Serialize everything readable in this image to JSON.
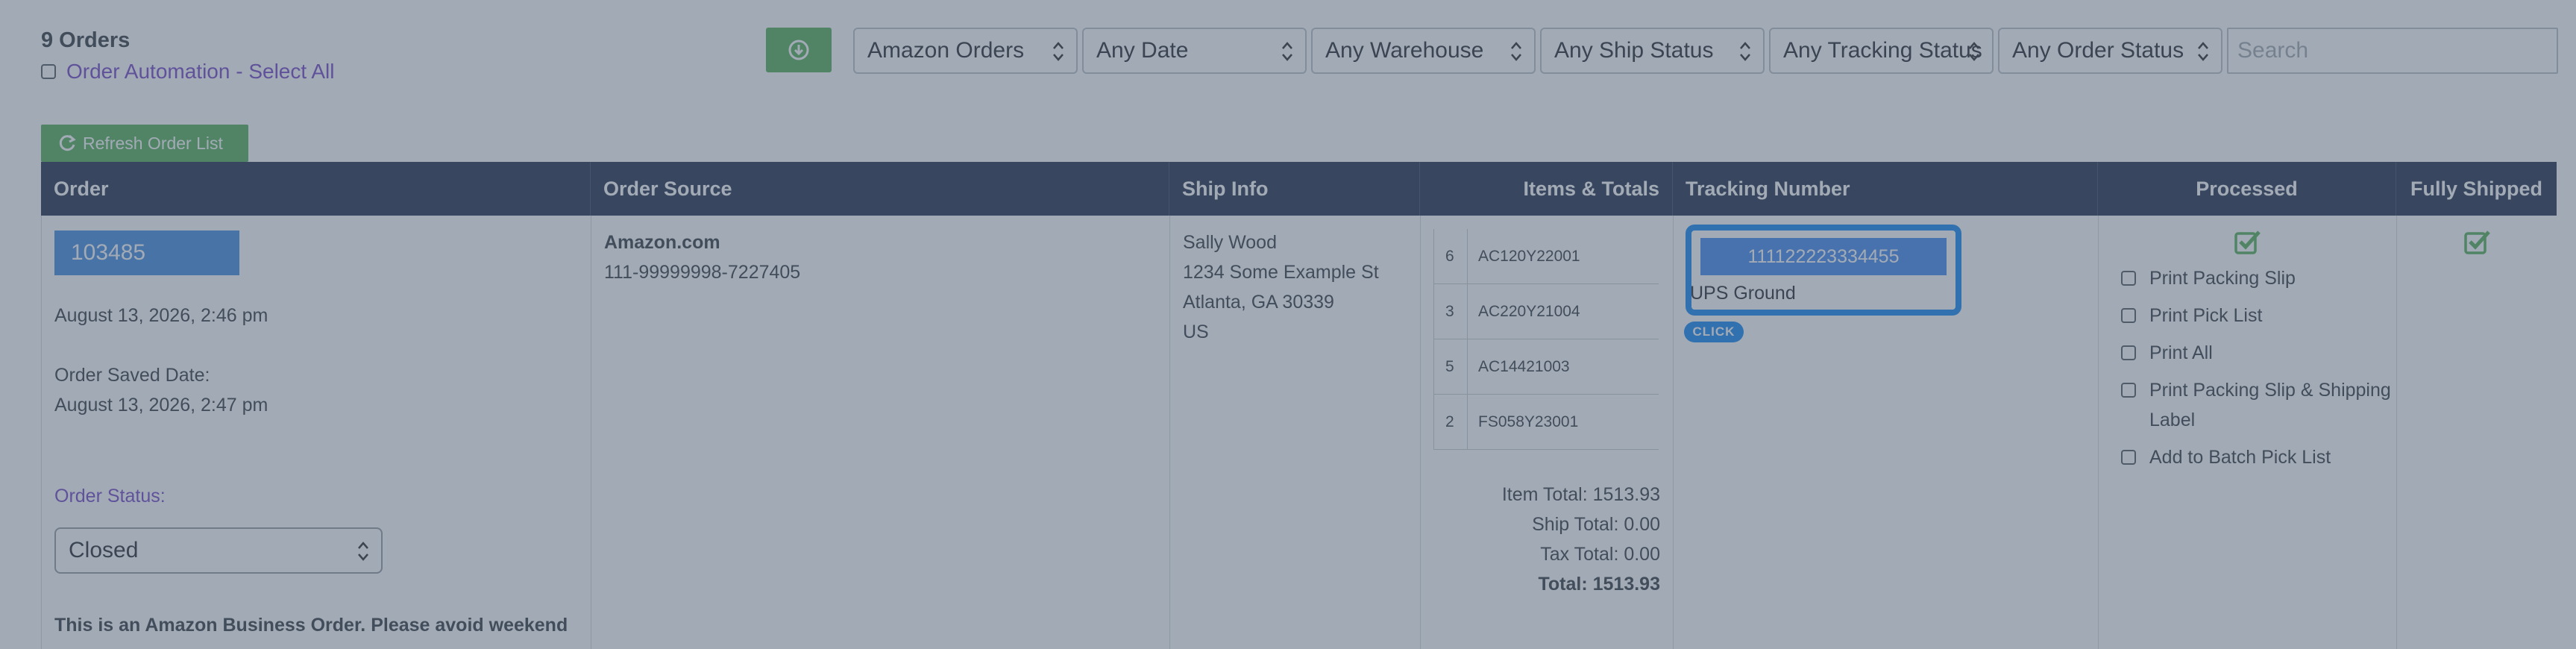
{
  "header": {
    "orders_count": "9 Orders",
    "automation_label": "Order Automation - Select All",
    "download_icon": "download-circle-icon"
  },
  "filters": [
    {
      "value": "Amazon Orders"
    },
    {
      "value": "Any Date"
    },
    {
      "value": "Any Warehouse"
    },
    {
      "value": "Any Ship Status"
    },
    {
      "value": "Any Tracking Status"
    },
    {
      "value": "Any Order Status"
    }
  ],
  "search": {
    "placeholder": "Search"
  },
  "refresh_label": "Refresh Order List",
  "columns": [
    "Order",
    "Order Source",
    "Ship Info",
    "Items & Totals",
    "Tracking Number",
    "Processed",
    "Fully Shipped"
  ],
  "order": {
    "id": "103485",
    "date": "August 13, 2026, 2:46 pm",
    "saved_label": "Order Saved Date:",
    "saved_date": "August 13, 2026, 2:47 pm",
    "status_label": "Order Status:",
    "status_value": "Closed",
    "note": "This is an Amazon Business Order. Please avoid weekend"
  },
  "source": {
    "name": "Amazon.com",
    "number": "111-99999998-7227405"
  },
  "ship": {
    "name": "Sally Wood",
    "street": "1234 Some Example St",
    "city": "Atlanta, GA 30339",
    "country": "US"
  },
  "items": [
    {
      "qty": "6",
      "sku": "AC120Y22001"
    },
    {
      "qty": "3",
      "sku": "AC220Y21004"
    },
    {
      "qty": "5",
      "sku": "AC14421003"
    },
    {
      "qty": "2",
      "sku": "FS058Y23001"
    }
  ],
  "totals": {
    "item": "Item Total: 1513.93",
    "ship": "Ship Total: 0.00",
    "tax": "Tax Total: 0.00",
    "total": "Total: 1513.93"
  },
  "tracking": {
    "number": "111122223334455",
    "carrier": "UPS Ground",
    "badge": "CLICK"
  },
  "processed_options": [
    "Print Packing Slip",
    "Print Pick List",
    "Print All",
    "Print Packing Slip & Shipping Label",
    "Add to Batch Pick List"
  ],
  "colors": {
    "header_bg": "#2a3852",
    "accent_green": "#5bb35f",
    "accent_blue": "#4a90e2",
    "link_purple": "#7b4fc9",
    "focus_blue": "#1f8cf2"
  }
}
